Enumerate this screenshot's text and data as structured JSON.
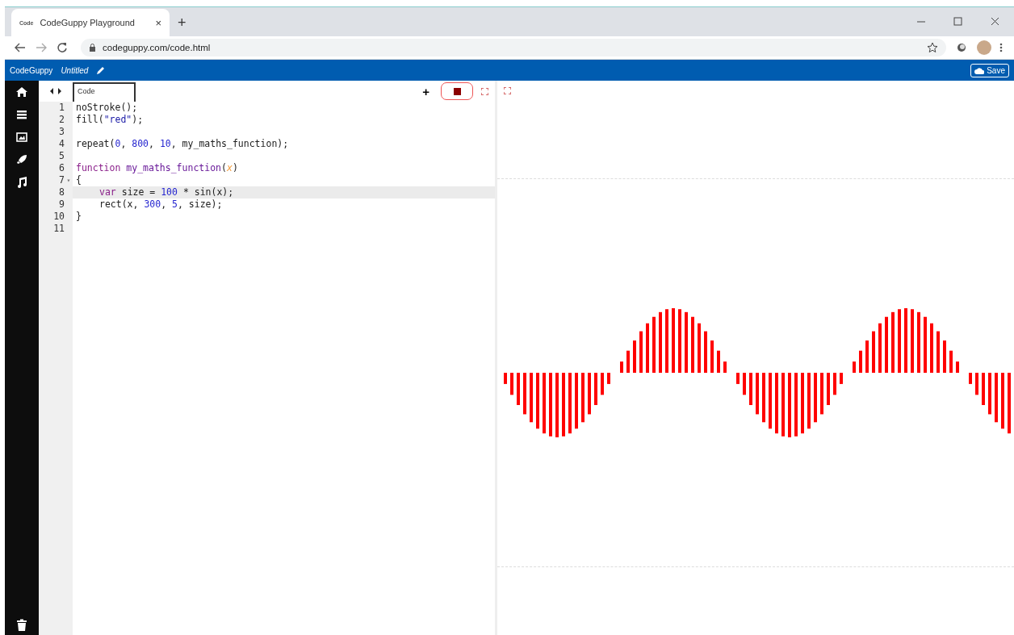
{
  "browser": {
    "tab_title": "CodeGuppy Playground",
    "favicon": "Code",
    "close_tab": "×",
    "new_tab": "+",
    "url": "codeguppy.com/code.html"
  },
  "app_bar": {
    "brand": "CodeGuppy",
    "file_name": "Untitled",
    "save": "Save"
  },
  "sidebar": {
    "items": [
      {
        "kind": "home"
      },
      {
        "kind": "menu"
      },
      {
        "kind": "image"
      },
      {
        "kind": "rocket"
      },
      {
        "kind": "music"
      }
    ]
  },
  "editor": {
    "tabs": [
      {
        "label": "Code",
        "selected": true
      }
    ],
    "add": "+",
    "lines": [
      {
        "number": "1",
        "highlighted": false,
        "tokens": [
          {
            "kind": "plain",
            "text": "noStroke();"
          }
        ]
      },
      {
        "number": "2",
        "highlighted": false,
        "tokens": [
          {
            "kind": "plain",
            "text": "fill("
          },
          {
            "kind": "string",
            "text": "\"red\""
          },
          {
            "kind": "plain",
            "text": ");"
          }
        ]
      },
      {
        "number": "3",
        "highlighted": false
      },
      {
        "number": "4",
        "highlighted": false,
        "tokens": [
          {
            "kind": "plain",
            "text": "repeat("
          },
          {
            "kind": "number",
            "text": "0"
          },
          {
            "kind": "plain",
            "text": ", "
          },
          {
            "kind": "number",
            "text": "800"
          },
          {
            "kind": "plain",
            "text": ", "
          },
          {
            "kind": "number",
            "text": "10"
          },
          {
            "kind": "plain",
            "text": ", my_maths_function);"
          }
        ]
      },
      {
        "number": "5",
        "highlighted": false
      },
      {
        "number": "6",
        "highlighted": false,
        "tokens": [
          {
            "kind": "keyword",
            "text": "function"
          },
          {
            "kind": "def",
            "text": "my_maths_function"
          },
          {
            "kind": "plain",
            "text": "("
          },
          {
            "kind": "param",
            "text": "x"
          },
          {
            "kind": "plain",
            "text": ")"
          }
        ]
      },
      {
        "number": "7",
        "highlighted": false,
        "fold_marker": "▾",
        "tokens": [
          {
            "kind": "plain",
            "text": "{"
          }
        ],
        "children": [
          {
            "number": "8",
            "highlighted": true,
            "tokens": [
              {
                "kind": "keyword",
                "text": "var"
              },
              {
                "kind": "plain",
                "text": " size = "
              },
              {
                "kind": "number",
                "text": "100"
              },
              {
                "kind": "plain",
                "text": " * sin(x);"
              }
            ]
          },
          {
            "number": "9",
            "highlighted": false,
            "tokens": [
              {
                "kind": "plain",
                "text": "rect(x, "
              },
              {
                "kind": "number",
                "text": "300"
              },
              {
                "kind": "plain",
                "text": ", "
              },
              {
                "kind": "number",
                "text": "5"
              },
              {
                "kind": "plain",
                "text": ", size);"
              }
            ]
          }
        ]
      },
      {
        "number": "10",
        "highlighted": false,
        "tokens": [
          {
            "kind": "plain",
            "text": "}"
          }
        ]
      },
      {
        "number": "11",
        "highlighted": false
      }
    ]
  }
}
